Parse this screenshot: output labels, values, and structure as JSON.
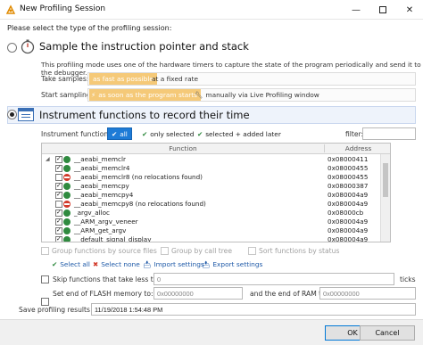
{
  "window": {
    "title": "New Profiling Session"
  },
  "prompt": "Please select the type of the profiling session:",
  "mode_sampling": {
    "title": "Sample the instruction pointer and stack",
    "description": "This profiling mode uses one of the hardware timers to capture the state of the program periodically and send it to the debugger.",
    "take_samples_label": "Take samples:",
    "take_samples_options": [
      "as fast as possible",
      "at a fixed rate"
    ],
    "start_sampling_label": "Start sampling:",
    "start_sampling_options": [
      "as soon as the program starts",
      "manually via Live Profiling window"
    ]
  },
  "mode_instrument": {
    "title": "Instrument functions to record their time",
    "functions_label": "Instrument functions:",
    "filter_buttons": [
      "all",
      "only selected",
      "selected + added later"
    ],
    "filter_label": "filter:",
    "filter_value": ""
  },
  "grid": {
    "columns": [
      "Function",
      "Address"
    ],
    "rows": [
      {
        "name": "__aeabi_memclr",
        "address": "0x08000411",
        "checked": true,
        "status": "ok"
      },
      {
        "name": "__aeabi_memclr4",
        "address": "0x08000455",
        "checked": true,
        "status": "ok"
      },
      {
        "name": "__aeabi_memclr8 (no relocations found)",
        "address": "0x08000455",
        "checked": false,
        "status": "no"
      },
      {
        "name": "__aeabi_memcpy",
        "address": "0x08000387",
        "checked": true,
        "status": "ok"
      },
      {
        "name": "__aeabi_memcpy4",
        "address": "0x080004a9",
        "checked": true,
        "status": "ok"
      },
      {
        "name": "__aeabi_memcpy8 (no relocations found)",
        "address": "0x080004a9",
        "checked": false,
        "status": "no"
      },
      {
        "name": "_argv_alloc",
        "address": "0x08000cb",
        "checked": true,
        "status": "ok"
      },
      {
        "name": "__ARM_argv_veneer",
        "address": "0x080004a9",
        "checked": true,
        "status": "ok"
      },
      {
        "name": "__ARM_get_argv",
        "address": "0x080004a9",
        "checked": true,
        "status": "ok"
      },
      {
        "name": "__default_signal_display",
        "address": "0x080004a9",
        "checked": true,
        "status": "ok"
      }
    ]
  },
  "grouping": {
    "group_by_source": "Group functions by source files",
    "group_by_call_tree": "Group by call tree",
    "sort_by_status": "Sort functions by status"
  },
  "actions": {
    "select_all": "Select all",
    "select_none": "Select none",
    "import": "Import settings",
    "export": "Export settings"
  },
  "skip": {
    "label": "Skip functions that take less than",
    "value": "0",
    "unit": "ticks"
  },
  "flash": {
    "label": "Set end of FLASH memory to:",
    "value": "0x00000000",
    "ram_label": "and the end of RAM to",
    "ram_value": "0x00000000"
  },
  "save": {
    "label": "Save profiling results as:",
    "value": "11/19/2018 1:54:48 PM",
    "checked": true
  },
  "buttons": {
    "ok": "OK",
    "cancel": "Cancel"
  },
  "colors": {
    "accent": "#1e7bd6",
    "selected_option": "#f3b13c",
    "ok_icon": "#2f8a3f",
    "no_icon": "#d23a2a"
  }
}
